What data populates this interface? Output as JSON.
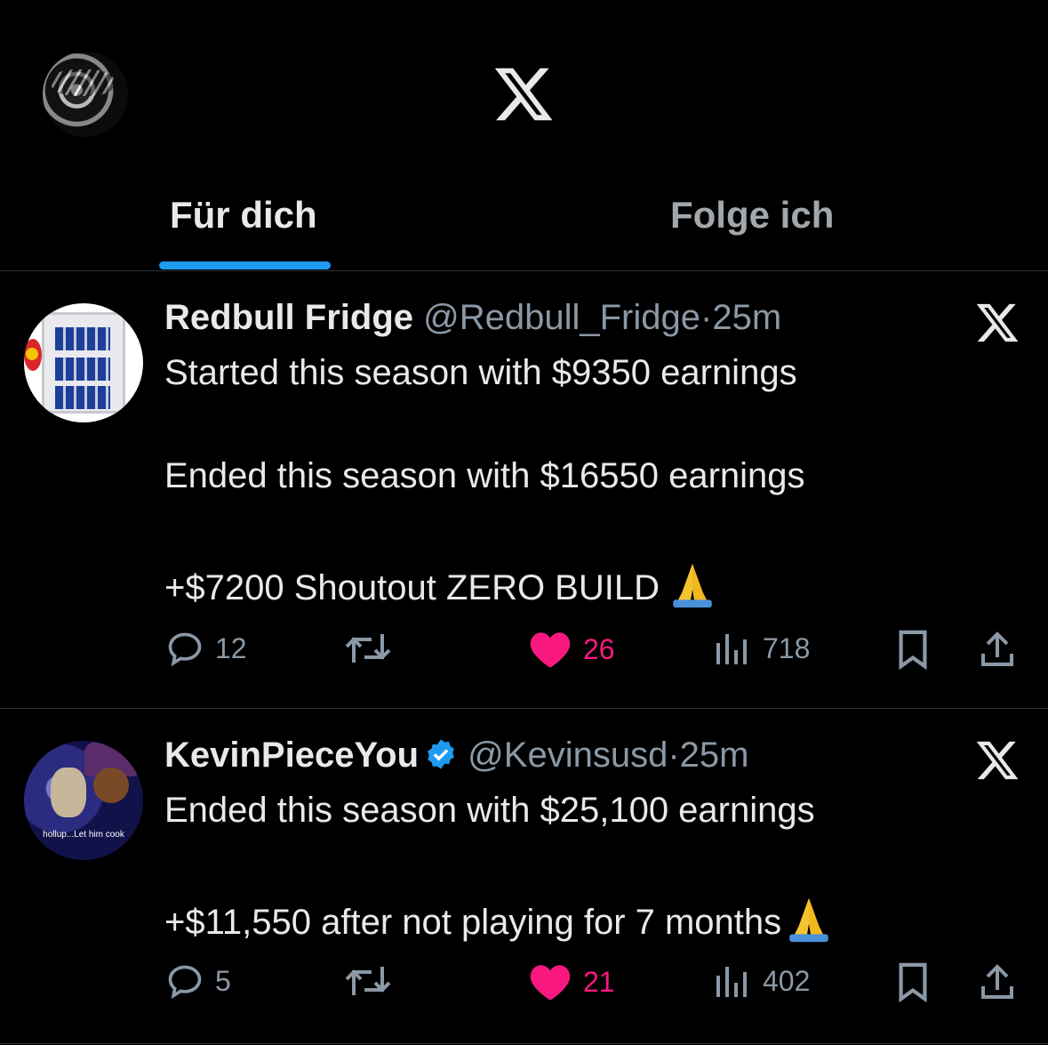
{
  "header": {
    "avatar": "profile-avatar",
    "logo": "x-logo"
  },
  "tabs": [
    {
      "label": "Für dich",
      "active": true
    },
    {
      "label": "Folge ich",
      "active": false
    }
  ],
  "colors": {
    "background": "#000000",
    "accent": "#1d9bf0",
    "like": "#f91880",
    "muted": "#8b98a5"
  },
  "tweets": [
    {
      "display_name": "Redbull Fridge",
      "handle": "@Redbull_Fridge",
      "sep": "·",
      "time": "25m",
      "verified": false,
      "lines": [
        "Started this season with $9350 earnings",
        "Ended this season with $16550 earnings",
        "+$7200 Shoutout ZERO BUILD"
      ],
      "emoji": "folded-hands",
      "replies": "12",
      "reposts": "",
      "likes": "26",
      "liked": true,
      "views": "718"
    },
    {
      "display_name": "KevinPieceYou",
      "handle": "@Kevinsusd",
      "sep": "·",
      "time": "25m",
      "verified": true,
      "avatar_caption": "hollup...Let him cook",
      "lines": [
        "Ended this season with $25,100 earnings",
        "+$11,550 after not playing for 7 months"
      ],
      "emoji": "folded-hands",
      "replies": "5",
      "reposts": "",
      "likes": "21",
      "liked": true,
      "views": "402"
    }
  ]
}
